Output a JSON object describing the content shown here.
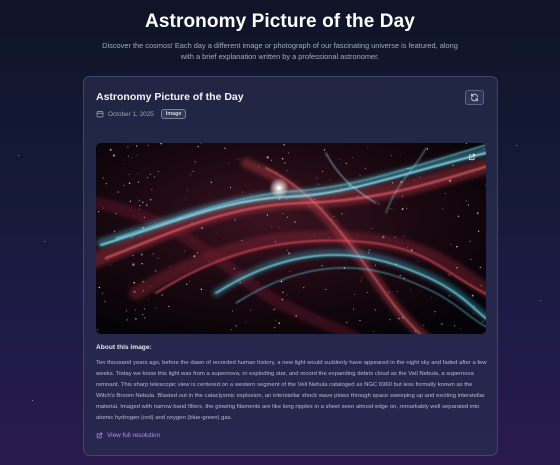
{
  "header": {
    "title": "Astronomy Picture of the Day",
    "subtitle": "Discover the cosmos! Each day a different image or photograph of our fascinating universe is featured, along with a brief explanation written by a professional astronomer."
  },
  "card": {
    "title": "Astronomy Picture of the Day",
    "date": "October 1, 2025",
    "media_type": "Image",
    "about_heading": "About this image:",
    "explanation": "Ten thousand years ago, before the dawn of recorded human history, a new light would suddenly have appeared in the night sky and faded after a few weeks. Today we know this light was from a supernova, or exploding star, and record the expanding debris cloud as the Veil Nebula, a supernova remnant. This sharp telescopic view is centered on a western segment of the Veil Nebula cataloged as NGC 6960 but less formally known as the Witch's Broom Nebula. Blasted out in the cataclysmic explosion, an interstellar shock wave plows through space sweeping up and exciting interstellar material. Imaged with narrow band filters, the glowing filaments are like long ripples in a sheet seen almost edge on, remarkably well separated into atomic hydrogen (red) and oxygen (blue-green) gas.",
    "full_res_label": "View full resolution"
  },
  "icons": {
    "refresh": "refresh-icon",
    "calendar": "calendar-icon",
    "external": "external-link-icon"
  },
  "colors": {
    "accent": "#b38df0",
    "nebula_red": "#c2384a",
    "nebula_cyan": "#5fd6e6"
  }
}
